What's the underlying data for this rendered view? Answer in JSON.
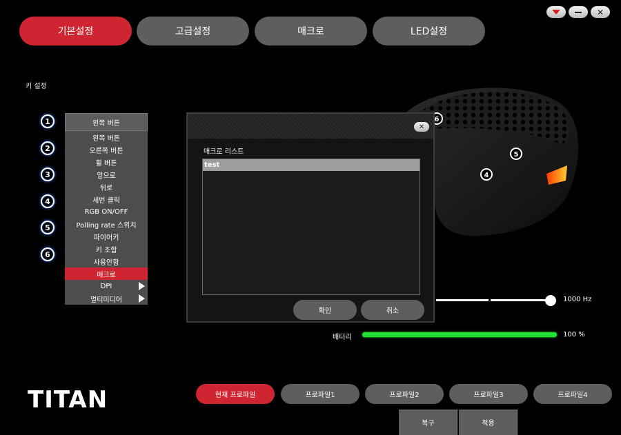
{
  "window": {
    "controls": [
      "menu-down",
      "minimize",
      "close"
    ]
  },
  "tabs": [
    {
      "label": "기본설정",
      "active": true
    },
    {
      "label": "고급설정",
      "active": false
    },
    {
      "label": "매크로",
      "active": false
    },
    {
      "label": "LED설정",
      "active": false
    }
  ],
  "key_settings": {
    "title": "키 설정",
    "numbers": [
      "1",
      "2",
      "3",
      "4",
      "5",
      "6"
    ],
    "dropdown": {
      "selected": "왼쪽 버튼",
      "options": [
        "왼쪽 버튼",
        "오른쪽 버튼",
        "휠 버튼",
        "앞으로",
        "뒤로",
        "세번 클릭",
        "RGB ON/OFF",
        "Polling rate 스위치",
        "파이어키",
        "키 조합",
        "사용안함",
        "매크로",
        "DPI",
        "멀티미디어"
      ],
      "highlighted": "매크로"
    }
  },
  "mouse_callouts": [
    "6",
    "5",
    "4"
  ],
  "dialog": {
    "list_label": "매크로 리스트",
    "items": [
      "test"
    ],
    "ok_label": "확인",
    "cancel_label": "취소"
  },
  "polling": {
    "value_label": "1000 Hz"
  },
  "battery": {
    "label": "배터리",
    "value_label": "100 %",
    "level_percent": 100,
    "color": "#22e034"
  },
  "logo": "TITAN",
  "profiles": [
    {
      "label": "현재 프로파일",
      "active": true
    },
    {
      "label": "프로파일1",
      "active": false
    },
    {
      "label": "프로파일2",
      "active": false
    },
    {
      "label": "프로파일3",
      "active": false
    },
    {
      "label": "프로파일4",
      "active": false
    }
  ],
  "bottom_buttons": [
    "복구",
    "적용"
  ],
  "colors": {
    "accent": "#cf2531",
    "button": "#5e5e5e"
  }
}
